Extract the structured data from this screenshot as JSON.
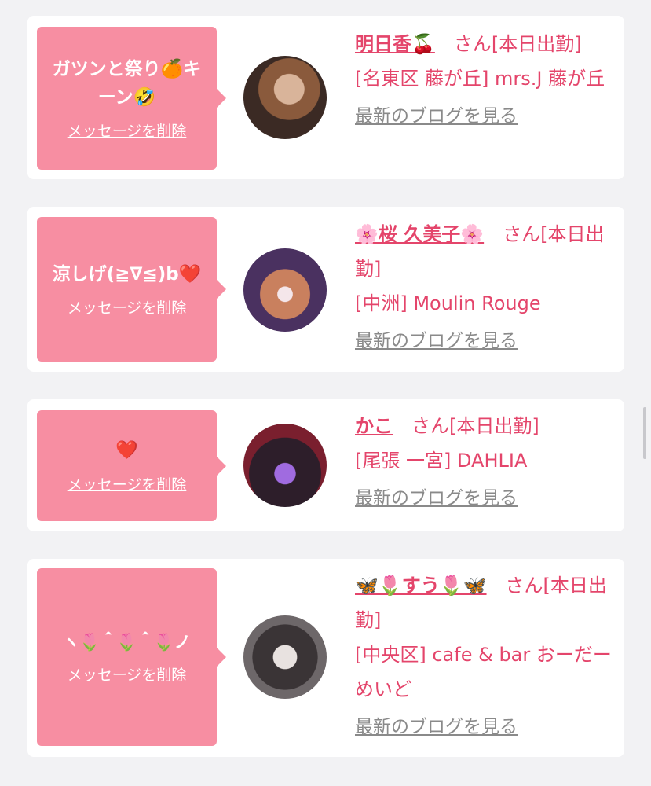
{
  "items": [
    {
      "message": "ガツンと祭り🍊キーン🤣",
      "delete_label": "メッセージを削除",
      "name": "明日香🍒",
      "suffix": "さん[本日出勤]",
      "location": "[名東区 藤が丘] mrs.J 藤が丘",
      "blog_label": "最新のブログを見る"
    },
    {
      "message": "涼しげ(≧∇≦)b❤️",
      "delete_label": "メッセージを削除",
      "name": "🌸桜 久美子🌸",
      "suffix": "さん[本日出勤]",
      "location": "[中洲] Moulin Rouge",
      "blog_label": "最新のブログを見る"
    },
    {
      "message": "❤️",
      "delete_label": "メッセージを削除",
      "name": "かこ",
      "suffix": "さん[本日出勤]",
      "location": "[尾張 一宮] DAHLIA",
      "blog_label": "最新のブログを見る"
    },
    {
      "message": "ヽ🌷＾🌷＾🌷ノ",
      "delete_label": "メッセージを削除",
      "name": "🦋🌷すう🌷🦋",
      "suffix": "さん[本日出勤]",
      "location": "[中央区] cafe & bar おーだーめいど",
      "blog_label": "最新のブログを見る"
    }
  ],
  "colors": {
    "bubble": "#f78ea2",
    "accent": "#e4456b",
    "muted": "#8a8a8a"
  }
}
